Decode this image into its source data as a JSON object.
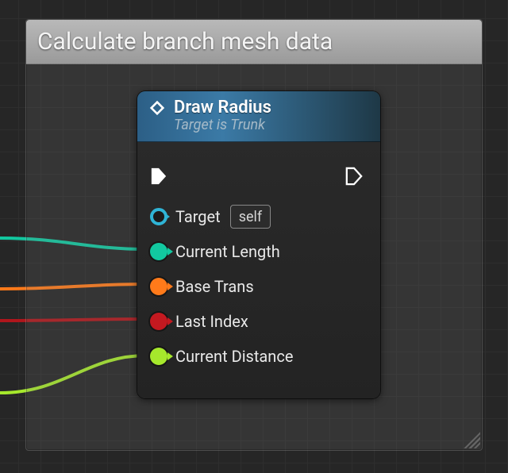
{
  "comment": {
    "title": "Calculate branch mesh data"
  },
  "node": {
    "title": "Draw Radius",
    "subtitle": "Target is Trunk",
    "pins": {
      "target": {
        "label": "Target",
        "default": "self",
        "color": "#2fb4d6"
      },
      "current_length": {
        "label": "Current Length",
        "color": "#12c8a0"
      },
      "base_trans": {
        "label": "Base Trans",
        "color": "#ff7a1a"
      },
      "last_index": {
        "label": "Last Index",
        "color": "#c41920"
      },
      "current_distance": {
        "label": "Current Distance",
        "color": "#a6e82c"
      }
    }
  }
}
